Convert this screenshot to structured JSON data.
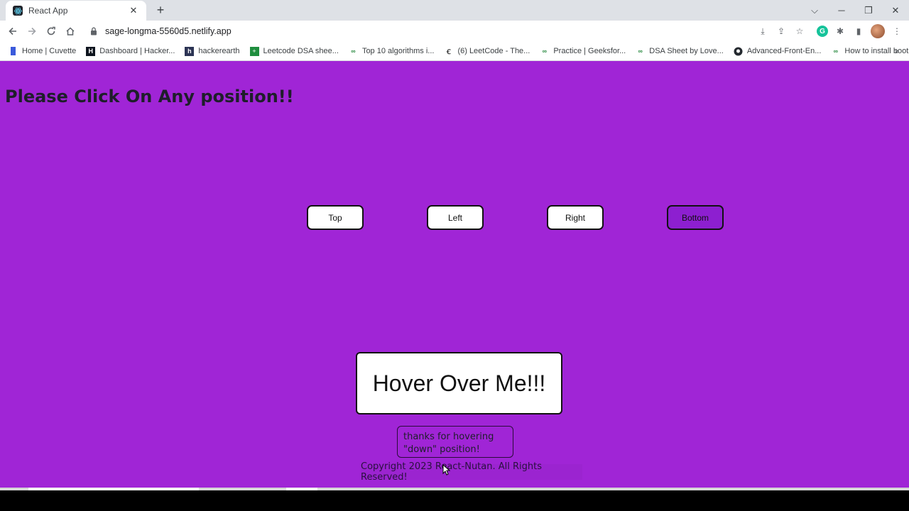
{
  "browser": {
    "tab_title": "React App",
    "tab_close": "✕",
    "new_tab": "+",
    "url": "sage-longma-5560d5.netlify.app",
    "bookmarks": [
      {
        "label": "Home | Cuvette",
        "icon": "cuvette-icon"
      },
      {
        "label": "Dashboard | Hacker...",
        "icon": "hackerrank-icon"
      },
      {
        "label": "hackerearth",
        "icon": "hackerearth-icon"
      },
      {
        "label": "Leetcode DSA shee...",
        "icon": "sheets-icon"
      },
      {
        "label": "Top 10 algorithms i...",
        "icon": "geeksforgeeks-icon"
      },
      {
        "label": "(6) LeetCode - The...",
        "icon": "leetcode-icon"
      },
      {
        "label": "Practice | Geeksfor...",
        "icon": "geeksforgeeks-icon"
      },
      {
        "label": "DSA Sheet by Love...",
        "icon": "geeksforgeeks-icon"
      },
      {
        "label": "Advanced-Front-En...",
        "icon": "github-icon"
      },
      {
        "label": "How to install boot...",
        "icon": "geeksforgeeks-icon"
      }
    ],
    "bookmarks_more": "»"
  },
  "page": {
    "title": "Please Click On Any position!!",
    "buttons": [
      {
        "label": "Top",
        "active": false
      },
      {
        "label": "Left",
        "active": false
      },
      {
        "label": "Right",
        "active": false
      },
      {
        "label": "Bottom",
        "active": true
      }
    ],
    "hover_box": "Hover Over Me!!!",
    "tooltip_line1": "thanks for hovering",
    "tooltip_line2": "\"down\" position!",
    "footer": "Copyright 2023 React-Nutan. All Rights Reserved!"
  },
  "colors": {
    "page_bg": "#a025d6",
    "active_button_bg": "#8d1fd0"
  }
}
